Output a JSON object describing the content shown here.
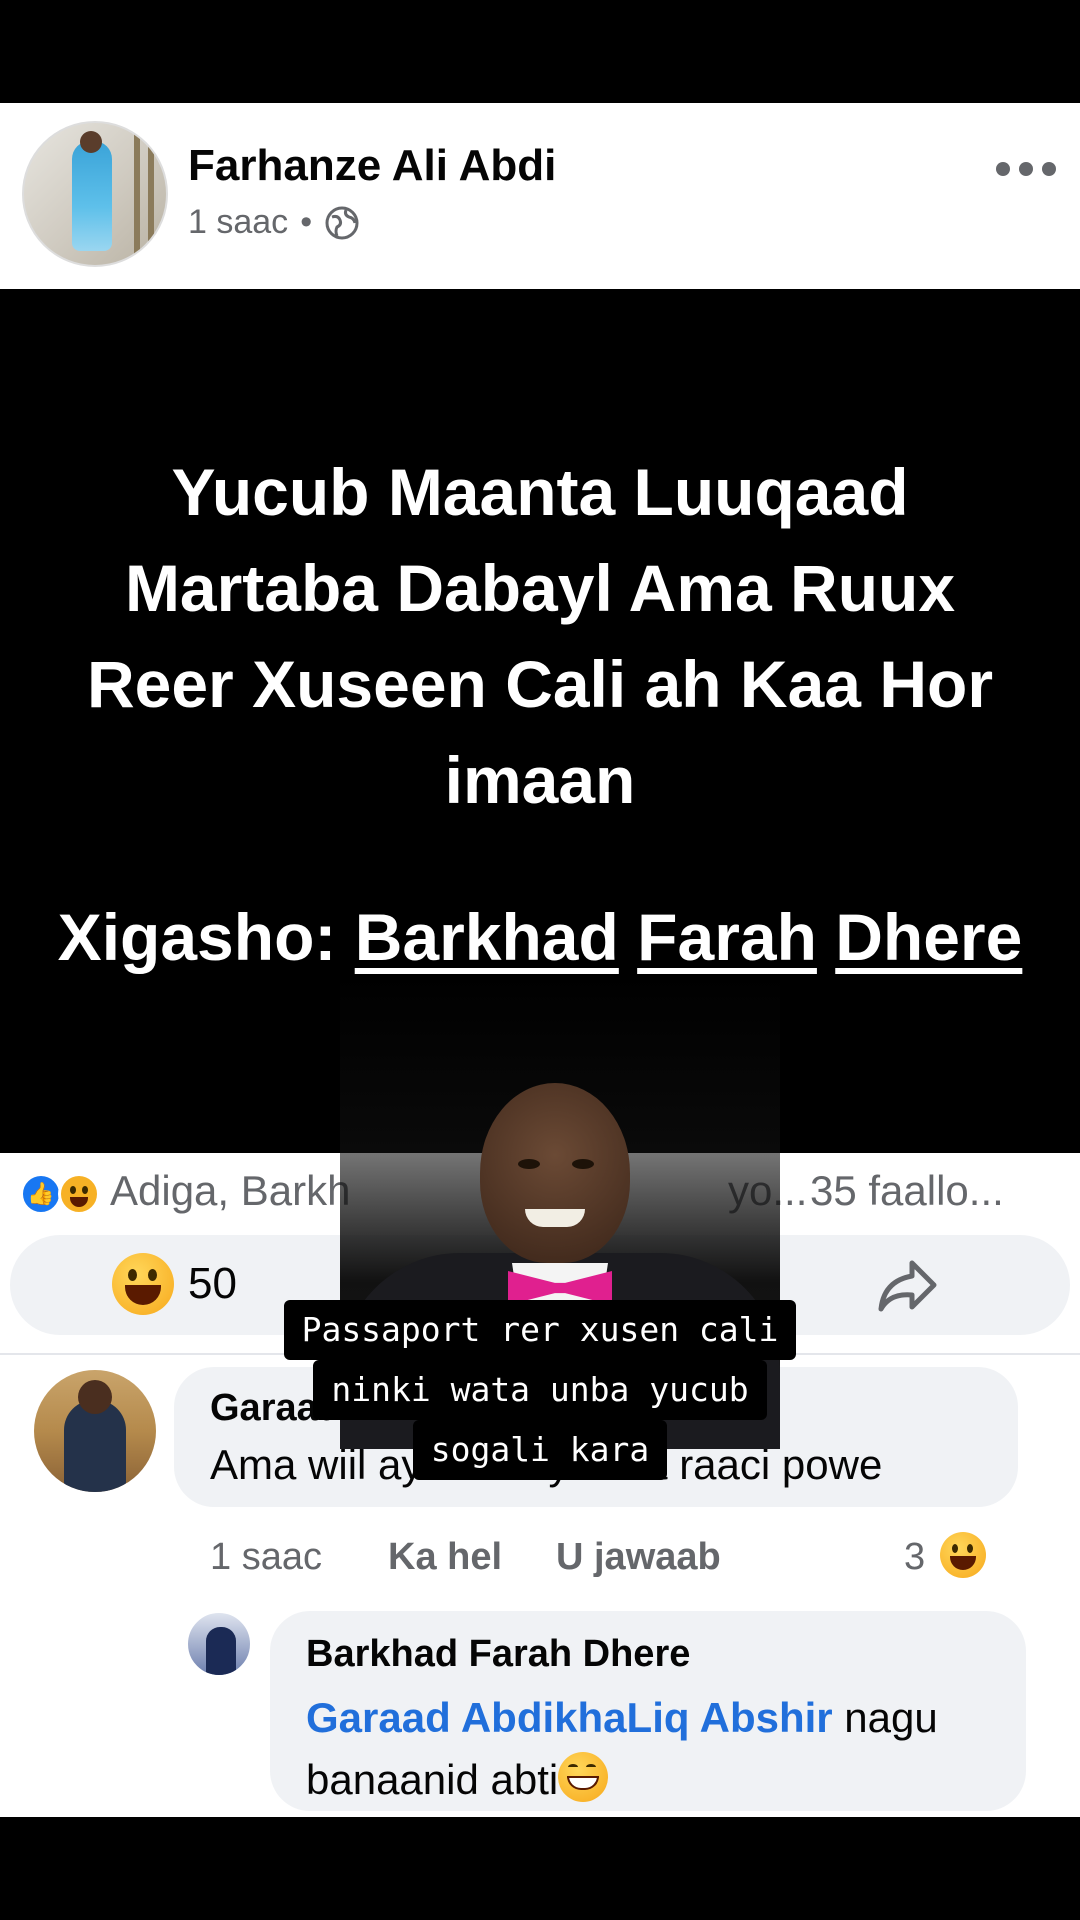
{
  "post": {
    "author": "Farhanze Ali Abdi",
    "time": "1 saac",
    "separator": "•",
    "quote": "Yucub Maanta Luuqaad\nMartaba   Dabayl Ama Ruux\nReer Xuseen Cali  ah Kaa Hor\nimaan",
    "attribution_prefix": "Xigasho:",
    "attribution_word1": "Barkhad",
    "attribution_word2": "Farah",
    "attribution_word3": "Dhere"
  },
  "reactions": {
    "names": "Adiga, Barkh",
    "names_tail": "yo...",
    "comments": "35 faallo...",
    "haha_count": "50"
  },
  "caption": {
    "line1": "Passaport rer xusen cali",
    "line2": "ninki wata unba yucub",
    "line3": "sogali kara"
  },
  "comments": [
    {
      "author": "Garaad AbdikhaLiq Abshir",
      "text": "Ama wiil ay abti u yihiina raaci powe",
      "time": "1 saac",
      "like_label": "Ka hel",
      "reply_label": "U jawaab",
      "reaction_count": "3"
    },
    {
      "author": "Barkhad Farah Dhere",
      "mention": "Garaad AbdikhaLiq Abshir",
      "text_after_mention": " nagu",
      "text_line2": "banaanid abti"
    }
  ],
  "colors": {
    "link": "#216fdb",
    "secondary_text": "#65676b",
    "like_blue": "#1877f2"
  },
  "icons": [
    "globe-icon",
    "more-icon",
    "like-icon",
    "haha-icon",
    "share-icon",
    "grin-emoji-icon"
  ]
}
